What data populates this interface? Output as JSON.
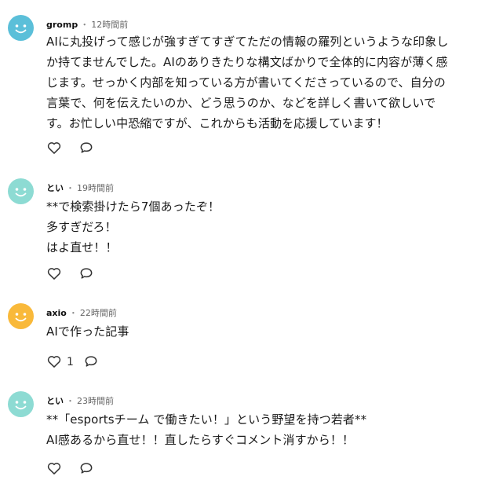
{
  "colors": {
    "avatar_blue": "#5bbfd9",
    "avatar_mint": "#8ddbd3",
    "avatar_orange": "#f9b93a",
    "face": "#ffffff",
    "icon": "#333333"
  },
  "icons": {
    "like": "heart-outline",
    "reply": "speech-bubble-outline"
  },
  "comments": [
    {
      "author": "gromp",
      "separator": "・",
      "time": "12時間前",
      "avatar_color": "avatar_blue",
      "lines": [
        "AIに丸投げって感じが強すぎてすぎてただの情報の羅列というような印象し",
        "か持てませんでした。AIのありきたりな構文ばかりで全体的に内容が薄く感",
        "じます。せっかく内部を知っている方が書いてくださっているので、自分の",
        "言葉で、何を伝えたいのか、どう思うのか、などを詳しく書いて欲しいで",
        "す。お忙しい中恐縮ですが、これからも活動を応援しています！"
      ],
      "like_count": ""
    },
    {
      "author": "とい",
      "separator": "・",
      "time": "19時間前",
      "avatar_color": "avatar_mint",
      "lines": [
        "**で検索掛けたら7個あったぞ！",
        "多すぎだろ！",
        "はよ直せ！！"
      ],
      "like_count": ""
    },
    {
      "author": "axio",
      "separator": "・",
      "time": "22時間前",
      "avatar_color": "avatar_orange",
      "lines": [
        "AIで作った記事"
      ],
      "like_count": "1"
    },
    {
      "author": "とい",
      "separator": "・",
      "time": "23時間前",
      "avatar_color": "avatar_mint",
      "lines": [
        "**「esportsチーム で働きたい！」という野望を持つ若者**",
        "AI感あるから直せ！！直したらすぐコメント消すから！！"
      ],
      "like_count": ""
    }
  ]
}
